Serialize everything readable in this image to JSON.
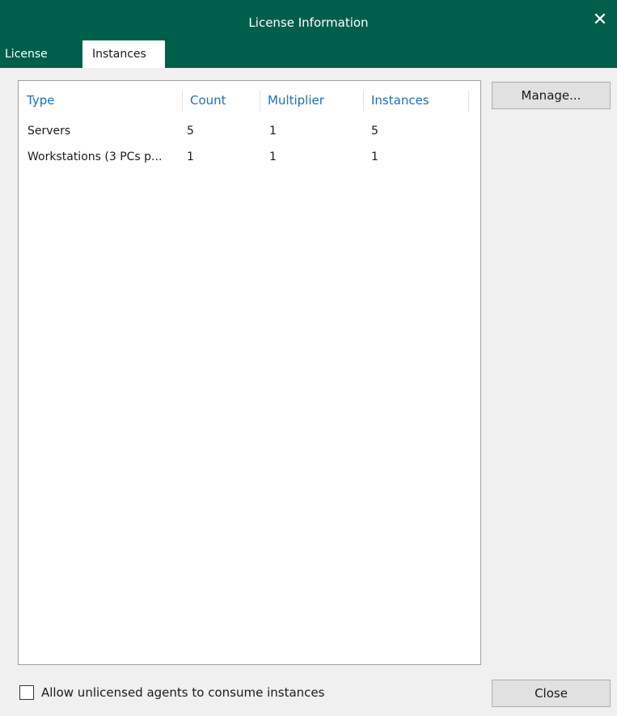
{
  "window": {
    "title": "License Information",
    "close_glyph": "✕"
  },
  "tabs": [
    {
      "label": "License",
      "active": false
    },
    {
      "label": "Instances",
      "active": true
    }
  ],
  "table": {
    "columns": [
      "Type",
      "Count",
      "Multiplier",
      "Instances"
    ],
    "rows": [
      {
        "type": "Servers",
        "count": "5",
        "multiplier": "1",
        "instances": "5"
      },
      {
        "type": "Workstations (3 PCs p...",
        "count": "1",
        "multiplier": "1",
        "instances": "1"
      }
    ]
  },
  "buttons": {
    "manage": "Manage...",
    "close": "Close"
  },
  "options": {
    "allow_unlicensed_label": "Allow unlicensed agents to consume instances",
    "allow_unlicensed_checked": false
  },
  "colors": {
    "titlebar": "#005f4b",
    "header_text": "#1f6fbf"
  }
}
